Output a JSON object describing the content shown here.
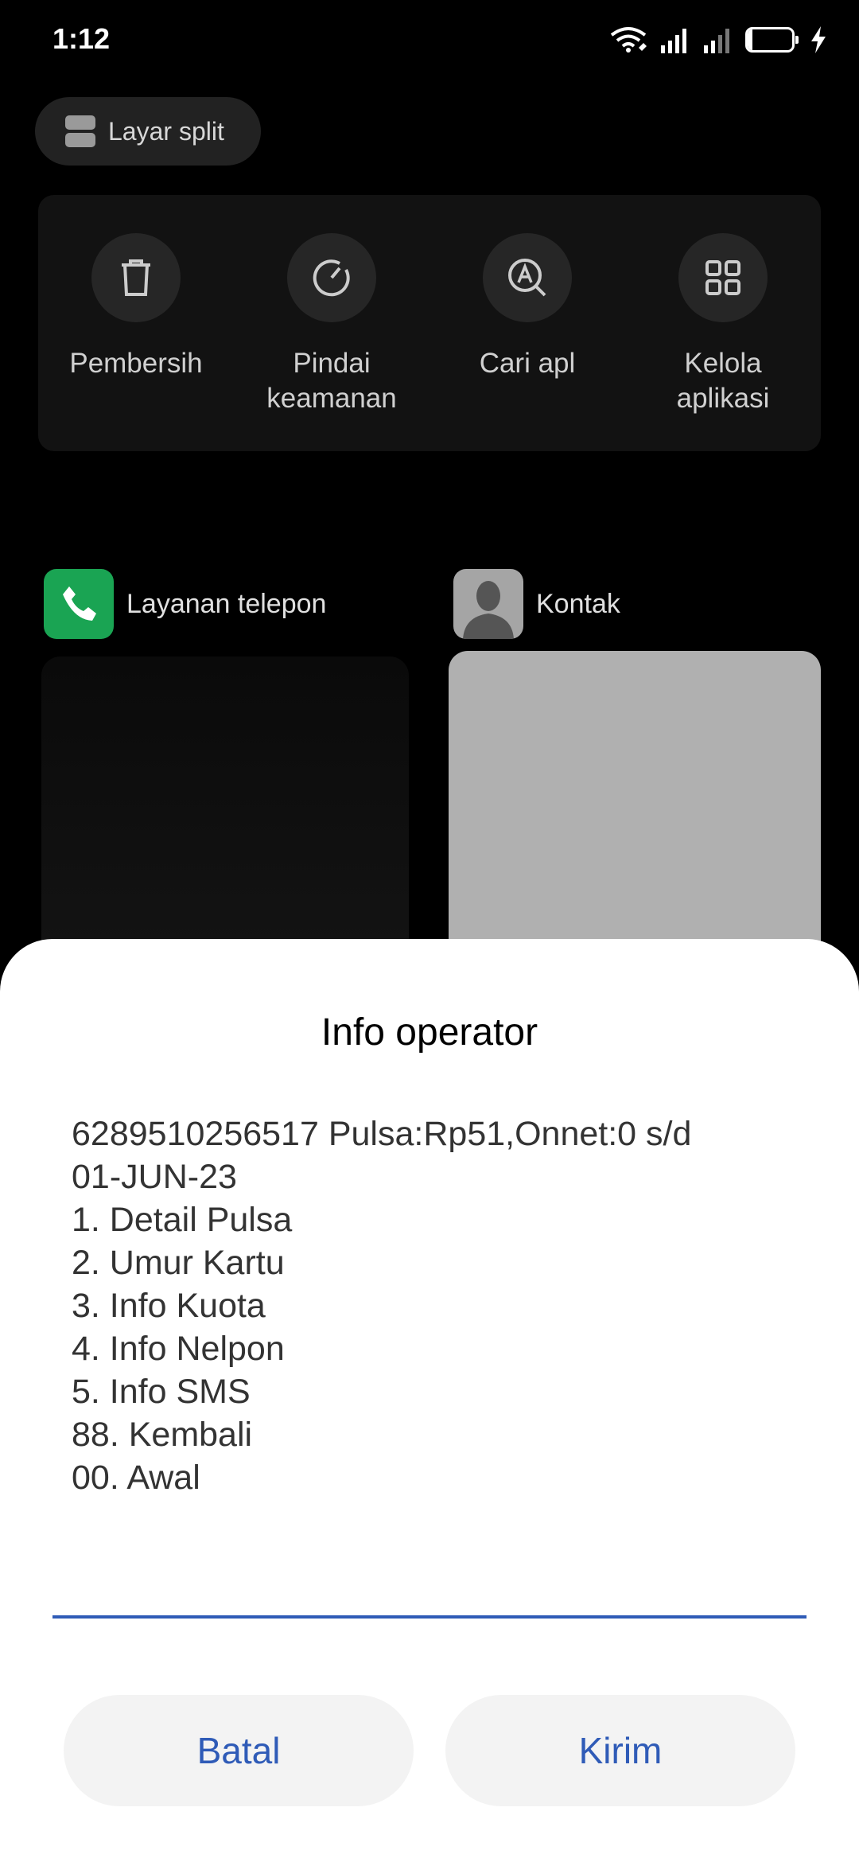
{
  "status_bar": {
    "time": "1:12",
    "battery": "10",
    "battery_level_percent": 10
  },
  "split_screen": {
    "label": "Layar split"
  },
  "tools": [
    {
      "label": "Pembersih",
      "icon": "trash-icon"
    },
    {
      "label": "Pindai\nkeamanan",
      "icon": "scan-gauge-icon"
    },
    {
      "label": "Cari apl",
      "icon": "search-app-icon"
    },
    {
      "label": "Kelola\naplikasi",
      "icon": "grid-apps-icon"
    }
  ],
  "recent_apps": {
    "phone": {
      "name": "Layanan telepon",
      "icon": "phone-icon",
      "color": "#1aa453"
    },
    "contacts": {
      "name": "Kontak",
      "icon": "contact-person-icon"
    }
  },
  "dialog": {
    "title": "Info operator",
    "message": "6289510256517 Pulsa:Rp51,Onnet:0 s/d\n01-JUN-23\n1. Detail Pulsa\n2. Umur Kartu\n3. Info Kuota\n4. Info Nelpon\n5. Info SMS\n88. Kembali\n00. Awal",
    "input_value": "",
    "cancel_label": "Batal",
    "send_label": "Kirim",
    "accent_color": "#2f5bb7"
  }
}
